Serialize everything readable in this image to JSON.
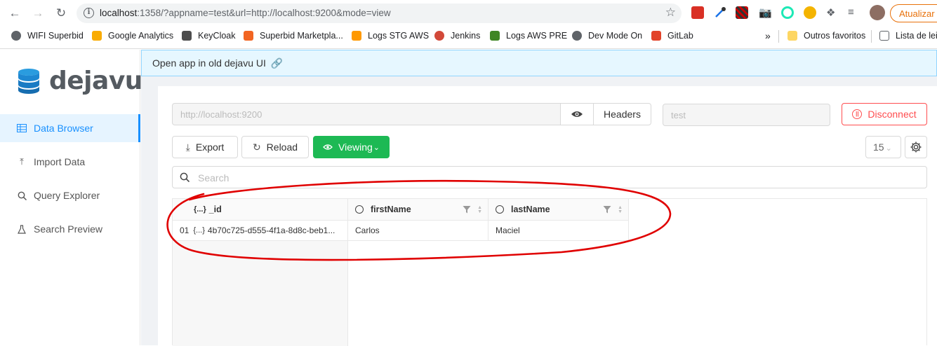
{
  "browser": {
    "url_host": "localhost",
    "url_rest": ":1358/?appname=test&url=http://localhost:9200&mode=view",
    "update_label": "Atualizar",
    "bookmarks": [
      {
        "label": "WIFI Superbid",
        "color": "#5f6368"
      },
      {
        "label": "Google Analytics",
        "color": "#f9ab00"
      },
      {
        "label": "KeyCloak",
        "color": "#4d4d4d"
      },
      {
        "label": "Superbid Marketpla...",
        "color": "#f26522"
      },
      {
        "label": "Logs STG AWS",
        "color": "#ff9900"
      },
      {
        "label": "Jenkins",
        "color": "#d24939"
      },
      {
        "label": "Logs AWS PRE",
        "color": "#3f8624"
      },
      {
        "label": "Dev Mode On",
        "color": "#5f6368"
      },
      {
        "label": "GitLab",
        "color": "#e24329"
      }
    ],
    "more_bookmarks": "»",
    "other_favorites": "Outros favoritos",
    "reading_list": "Lista de leit"
  },
  "sidebar": {
    "logo_text": "dejavu",
    "items": [
      {
        "label": "Data Browser",
        "icon": "table-icon",
        "active": true
      },
      {
        "label": "Import Data",
        "icon": "upload-icon",
        "active": false
      },
      {
        "label": "Query Explorer",
        "icon": "search-icon",
        "active": false
      },
      {
        "label": "Search Preview",
        "icon": "flask-icon",
        "active": false
      }
    ]
  },
  "banner": {
    "text": "Open app in old dejavu UI"
  },
  "toolbar": {
    "url_value": "http://localhost:9200",
    "headers_label": "Headers",
    "app_value": "test",
    "disconnect_label": "Disconnect",
    "export_label": "Export",
    "reload_label": "Reload",
    "mode_label": "Viewing",
    "page_size": "15",
    "search_placeholder": "Search"
  },
  "table": {
    "columns": [
      {
        "label": "_id",
        "prefix": "{...}"
      },
      {
        "label": "firstName"
      },
      {
        "label": "lastName"
      }
    ],
    "rows": [
      {
        "index": "01",
        "prefix": "{...}",
        "id": "4b70c725-d555-4f1a-8d8c-beb1...",
        "firstName": "Carlos",
        "lastName": "Maciel"
      }
    ]
  },
  "colors": {
    "accent": "#1890ff",
    "primary_button": "#1db954",
    "danger": "#ff4d4f",
    "annotation": "#e00000"
  }
}
